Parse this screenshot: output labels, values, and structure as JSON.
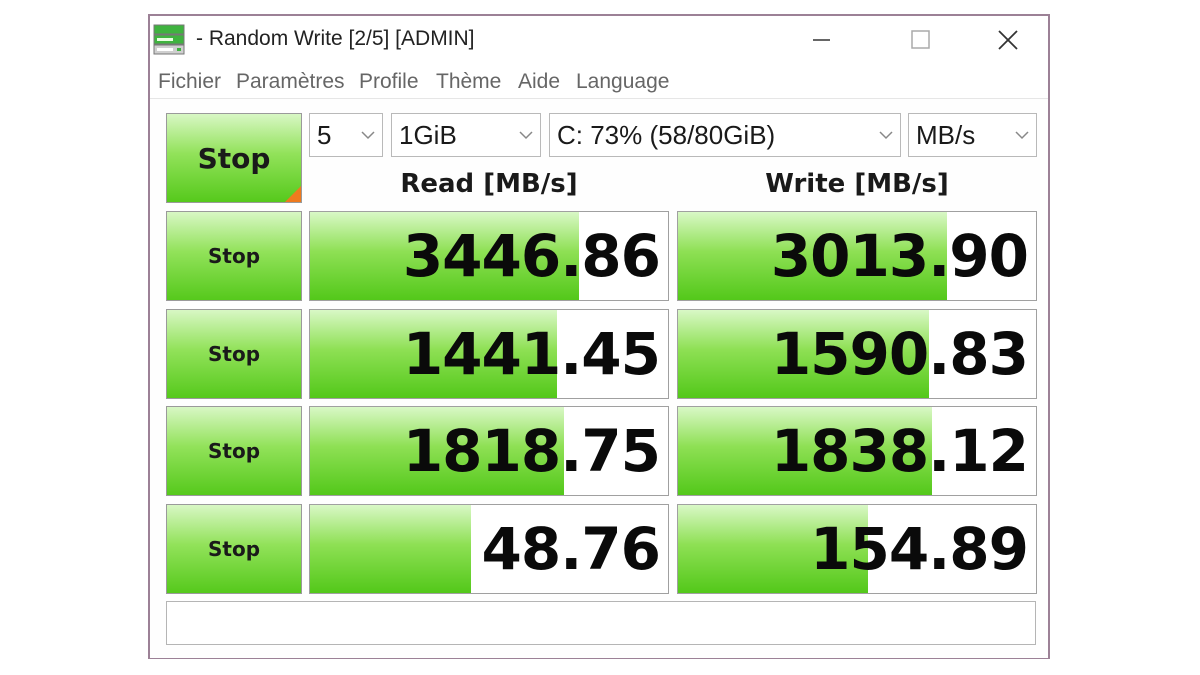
{
  "window": {
    "title": "- Random Write [2/5] [ADMIN]",
    "icon": "disk-icon"
  },
  "menu": {
    "items": [
      "Fichier",
      "Paramètres",
      "Profile",
      "Thème",
      "Aide",
      "Language"
    ]
  },
  "controls": {
    "all_button": "Stop",
    "count": "5",
    "size": "1GiB",
    "drive": "C: 73% (58/80GiB)",
    "unit": "MB/s"
  },
  "headers": {
    "read": "Read [MB/s]",
    "write": "Write [MB/s]"
  },
  "rows": [
    {
      "button": "Stop",
      "read": "3446.86",
      "write": "3013.90",
      "read_fill": 0.75,
      "write_fill": 0.75
    },
    {
      "button": "Stop",
      "read": "1441.45",
      "write": "1590.83",
      "read_fill": 0.69,
      "write_fill": 0.7
    },
    {
      "button": "Stop",
      "read": "1818.75",
      "write": "1838.12",
      "read_fill": 0.71,
      "write_fill": 0.71
    },
    {
      "button": "Stop",
      "read": "48.76",
      "write": "154.89",
      "read_fill": 0.45,
      "write_fill": 0.53
    }
  ],
  "comment": "",
  "colors": {
    "green_top": "#d8f7c4",
    "green_bottom": "#56c91c",
    "corner_accent": "#ee7a1e",
    "window_border": "#9c8196"
  }
}
